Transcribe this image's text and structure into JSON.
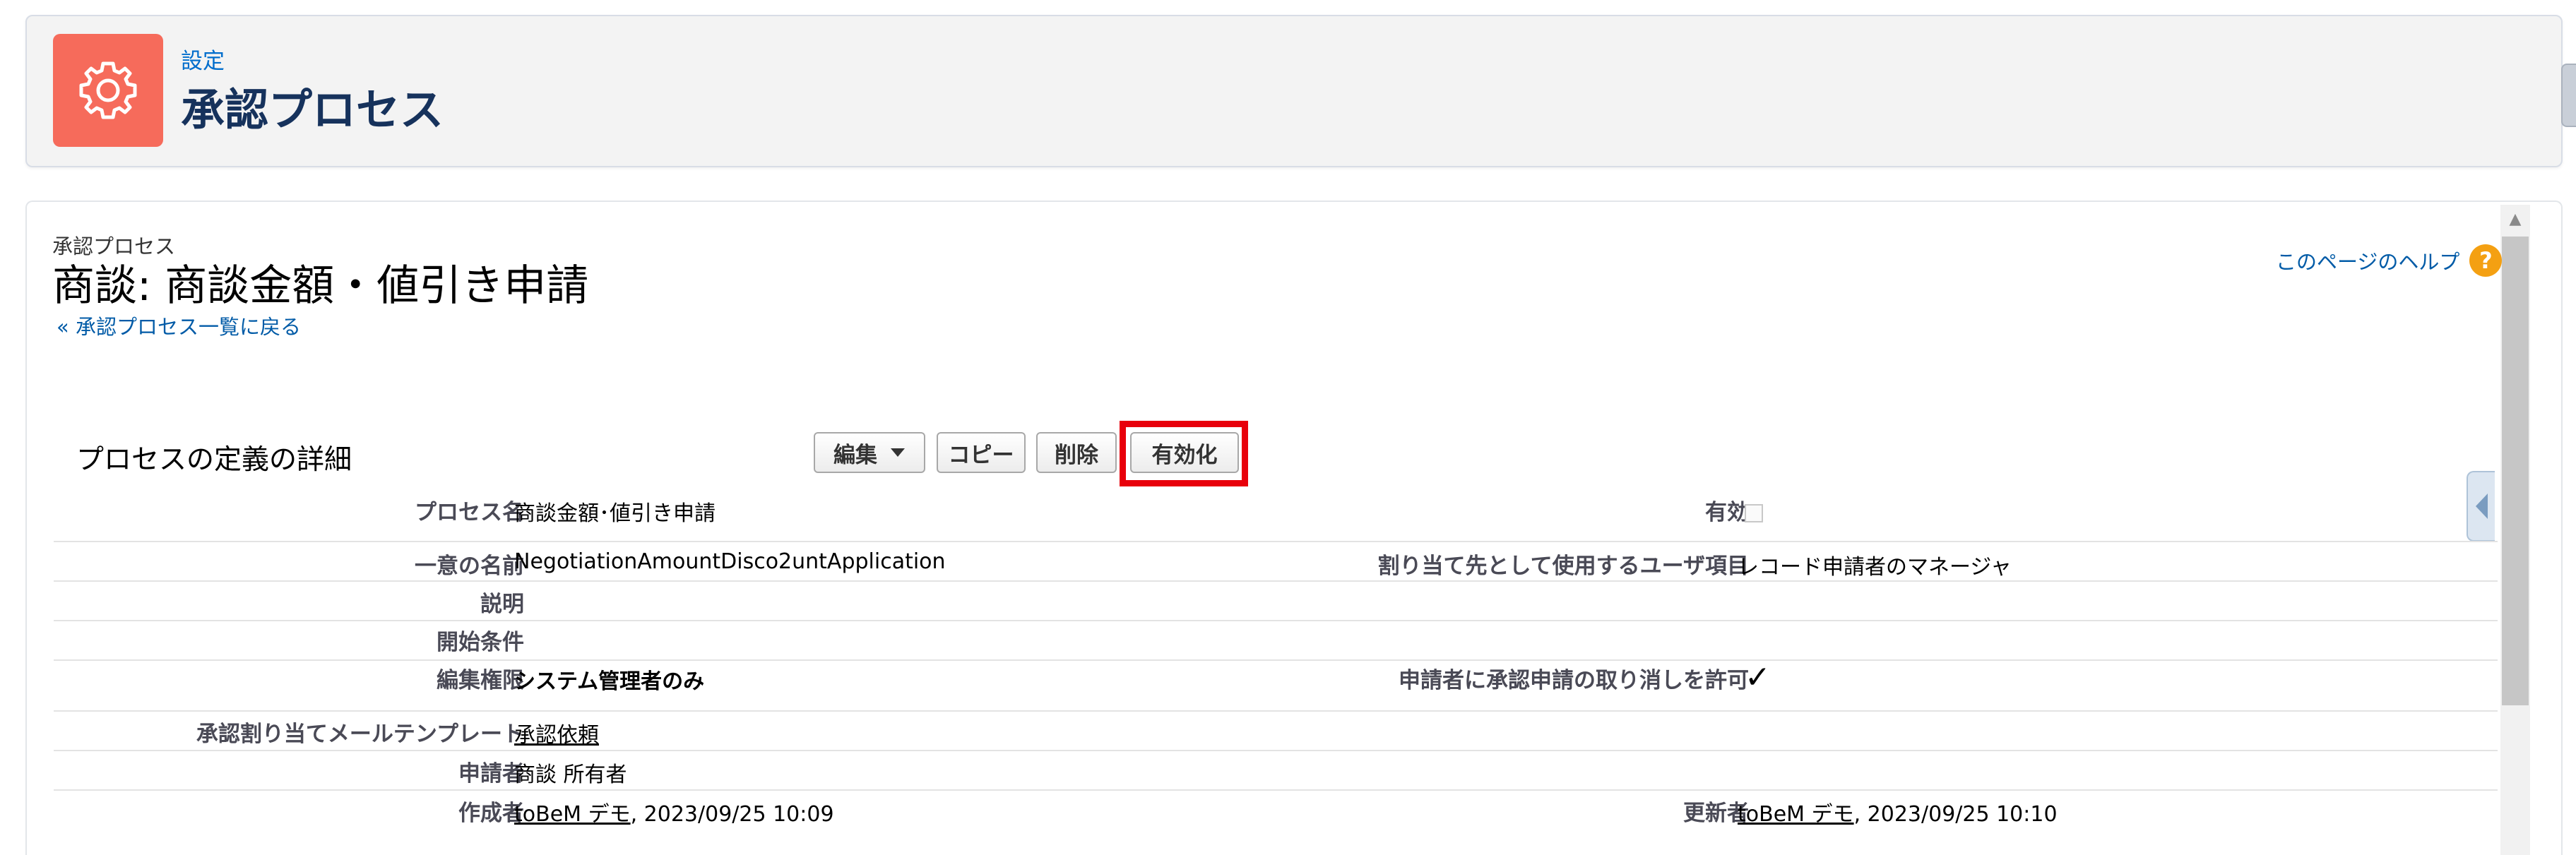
{
  "header": {
    "eyebrow": "設定",
    "title": "承認プロセス",
    "icon": "gear-icon"
  },
  "page": {
    "breadcrumb": "承認プロセス",
    "title": "商談: 商談金額・値引き申請",
    "back_link": "« 承認プロセス一覧に戻る",
    "help_link": "このページのヘルプ",
    "help_icon": "?"
  },
  "section": {
    "title": "プロセスの定義の詳細",
    "buttons": {
      "edit": "編集",
      "copy": "コピー",
      "delete": "削除",
      "activate": "有効化"
    }
  },
  "details": {
    "process_name_label": "プロセス名",
    "process_name": "商談金額･値引き申請",
    "active_label": "有効",
    "active_checked": false,
    "unique_name_label": "一意の名前",
    "unique_name": "NegotiationAmountDisco2untApplication",
    "assignee_field_label": "割り当て先として使用するユーザ項目",
    "assignee_field": "レコード申請者のマネージャ",
    "description_label": "説明",
    "description": "",
    "entry_criteria_label": "開始条件",
    "entry_criteria": "",
    "edit_permission_label": "編集権限",
    "edit_permission": "システム管理者のみ",
    "allow_recall_label": "申請者に承認申請の取り消しを許可",
    "allow_recall_mark": "✓",
    "email_template_label": "承認割り当てメールテンプレート",
    "email_template": "承認依頼",
    "submitter_label": "申請者",
    "submitter": "商談 所有者",
    "created_by_label": "作成者",
    "created_by_user": "toBeM デモ",
    "created_by_date": ", 2023/09/25 10:09",
    "modified_by_label": "更新者",
    "modified_by_user": "toBeM デモ",
    "modified_by_date": ", 2023/09/25 10:10"
  },
  "colors": {
    "header_icon_bg": "#f66b5b",
    "highlight": "#e8000b",
    "link": "#015ba7"
  }
}
